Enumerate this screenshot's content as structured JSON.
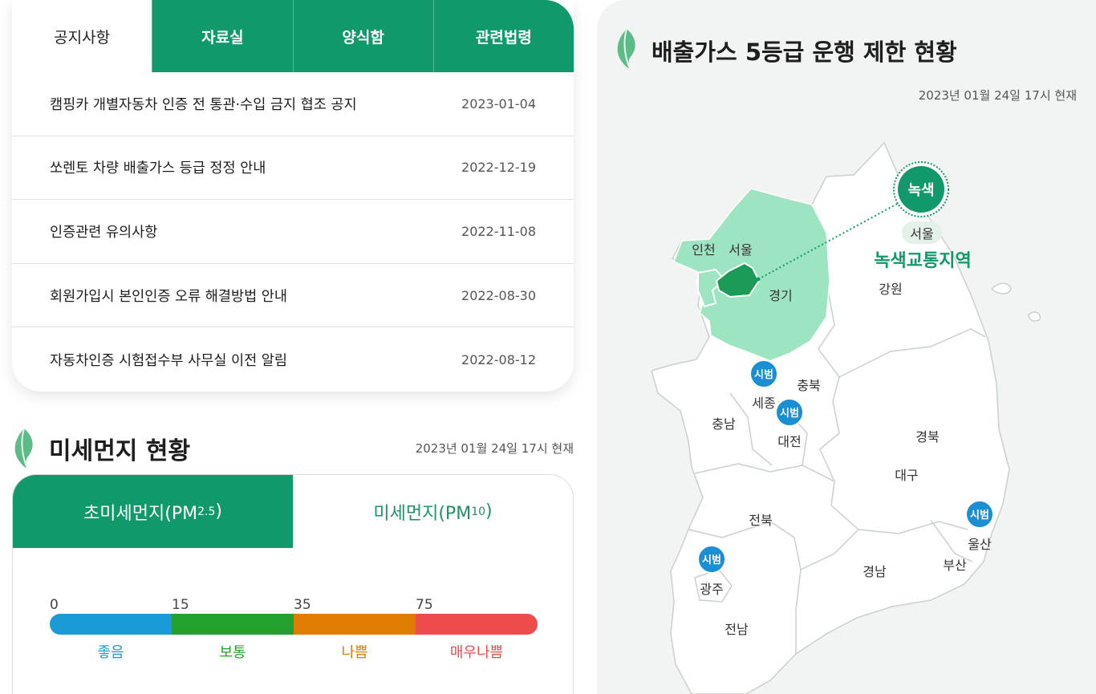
{
  "notice": {
    "tabs": [
      {
        "label": "공지사항",
        "active": true
      },
      {
        "label": "자료실",
        "active": false
      },
      {
        "label": "양식함",
        "active": false
      },
      {
        "label": "관련법령",
        "active": false
      }
    ],
    "items": [
      {
        "title": "캠핑카 개별자동차 인증 전 통관·수입 금지 협조 공지",
        "date": "2023-01-04"
      },
      {
        "title": "쏘렌토 차량 배출가스 등급 정정 안내",
        "date": "2022-12-19"
      },
      {
        "title": "인증관련 유의사항",
        "date": "2022-11-08"
      },
      {
        "title": "회원가입시 본인인증 오류 해결방법 안내",
        "date": "2022-08-30"
      },
      {
        "title": "자동차인증 시험접수부 사무실 이전 알림",
        "date": "2022-08-12"
      }
    ]
  },
  "dust": {
    "title": "미세먼지 현황",
    "timestamp": "2023년 01월 24일 17시 현재",
    "tab_pm25_main": "초미세먼지(PM",
    "tab_pm25_sub": "2.5",
    "tab_pm25_end": ")",
    "tab_pm10_main": "미세먼지(PM",
    "tab_pm10_sub": "10",
    "tab_pm10_end": ")",
    "scale_numbers": [
      "0",
      "15",
      "35",
      "75"
    ],
    "levels": [
      {
        "label": "좋음",
        "color": "#1a9ad6"
      },
      {
        "label": "보통",
        "color": "#23a02d"
      },
      {
        "label": "나쁨",
        "color": "#df7d00"
      },
      {
        "label": "매우나쁨",
        "color": "#ee4c4c"
      }
    ]
  },
  "map": {
    "title": "배출가스 5등급 운행 제한 현황",
    "timestamp": "2023년 01월 24일 17시 현재",
    "green_badge": "녹색",
    "green_badge_region": "서울",
    "green_zone_label": "녹색교통지역",
    "pilot_badge": "시범",
    "regions": {
      "incheon": "인천",
      "seoul": "서울",
      "gyeonggi": "경기",
      "gangwon": "강원",
      "chungbuk": "충북",
      "chungnam": "충남",
      "sejong": "세종",
      "daejeon": "대전",
      "gyeongbuk": "경북",
      "daegu": "대구",
      "jeonbuk": "전북",
      "gwangju": "광주",
      "jeonnam": "전남",
      "gyeongnam": "경남",
      "ulsan": "울산",
      "busan": "부산"
    },
    "colors": {
      "brand": "#11986b",
      "capital_area": "#9de5c1",
      "seoul": "#1c9a57",
      "pilot": "#1b8fd3"
    }
  }
}
